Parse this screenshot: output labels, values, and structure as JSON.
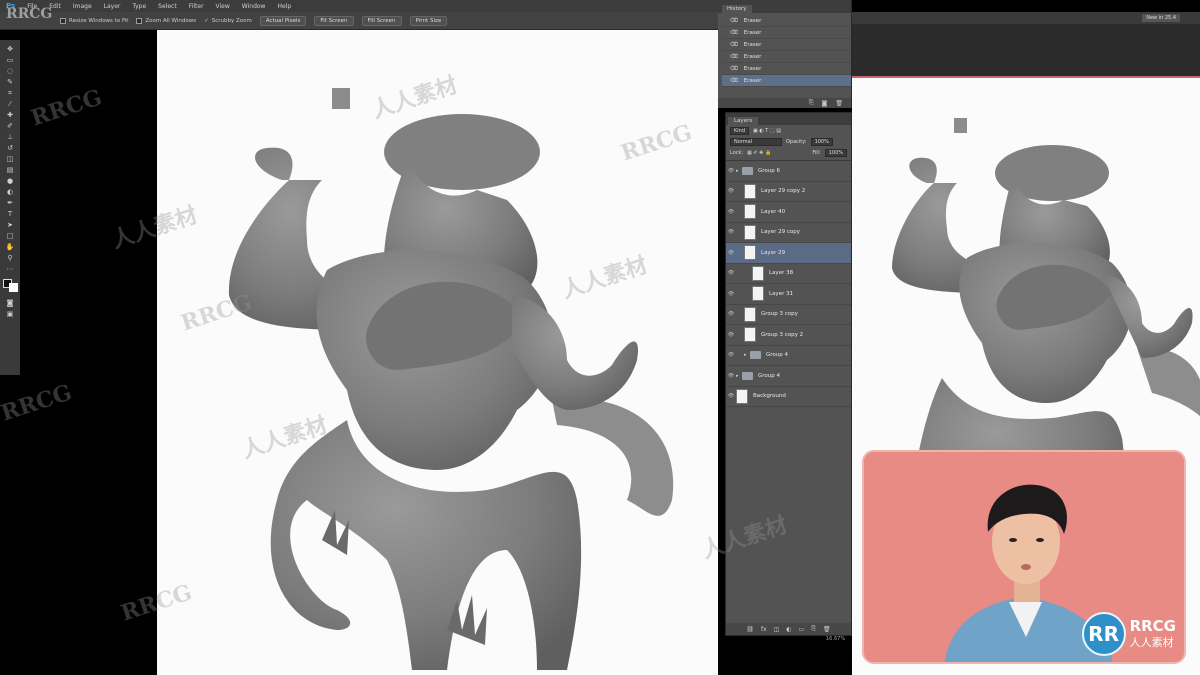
{
  "app": {
    "logo": "Ps"
  },
  "menu": [
    "File",
    "Edit",
    "Image",
    "Layer",
    "Type",
    "Select",
    "Filter",
    "View",
    "Window",
    "Help"
  ],
  "options_bar": {
    "checkboxes": [
      "Resize Windows to Fit",
      "Zoom All Windows",
      "Scrubby Zoom"
    ],
    "buttons": [
      "Actual Pixels",
      "Fit Screen",
      "Fill Screen",
      "Print Size"
    ]
  },
  "history": {
    "tab": "History",
    "items": [
      "Eraser",
      "Eraser",
      "Eraser",
      "Eraser",
      "Eraser",
      "Eraser"
    ],
    "selected_index": 5
  },
  "layers": {
    "tab": "Layers",
    "kind": "Kind",
    "blend_mode": "Normal",
    "opacity_label": "Opacity:",
    "opacity": "100%",
    "lock_label": "Lock:",
    "fill_label": "Fill:",
    "fill": "100%",
    "items": [
      {
        "name": "Group 6",
        "type": "group",
        "indent": 0
      },
      {
        "name": "Layer 29 copy 2",
        "type": "layer",
        "indent": 1
      },
      {
        "name": "Layer 40",
        "type": "layer",
        "indent": 1
      },
      {
        "name": "Layer 29 copy",
        "type": "layer",
        "indent": 1
      },
      {
        "name": "Layer 29",
        "type": "layer",
        "indent": 1,
        "selected": true
      },
      {
        "name": "Layer 38",
        "type": "layer",
        "indent": 2
      },
      {
        "name": "Layer 31",
        "type": "layer",
        "indent": 2
      },
      {
        "name": "Group 3 copy",
        "type": "layer",
        "indent": 1
      },
      {
        "name": "Group 3 copy 2",
        "type": "layer",
        "indent": 1
      },
      {
        "name": "Group 4",
        "type": "group",
        "indent": 1
      },
      {
        "name": "Group 4",
        "type": "group",
        "indent": 0
      },
      {
        "name": "Background",
        "type": "layer",
        "indent": 0
      }
    ]
  },
  "status": {
    "zoom": "16.67%"
  },
  "doc_right": {
    "zoom_field": "New in 25.4"
  },
  "watermark": {
    "top_left": "RRCG",
    "marks": [
      "RRCG",
      "人人素材",
      "RRCG",
      "人人素材",
      "RRCG",
      "人人素材",
      "RRCG",
      "人人素材",
      "RRCG",
      "人人素材"
    ]
  },
  "webcam_logo": {
    "badge": "RR",
    "title": "RRCG",
    "subtitle": "人人素材"
  },
  "colors": {
    "ui_dark": "#3c3c3c",
    "panel": "#535353",
    "selection": "#5b6b86",
    "webcam_bg": "#e88b85",
    "logo_blue": "#2f90c9"
  }
}
